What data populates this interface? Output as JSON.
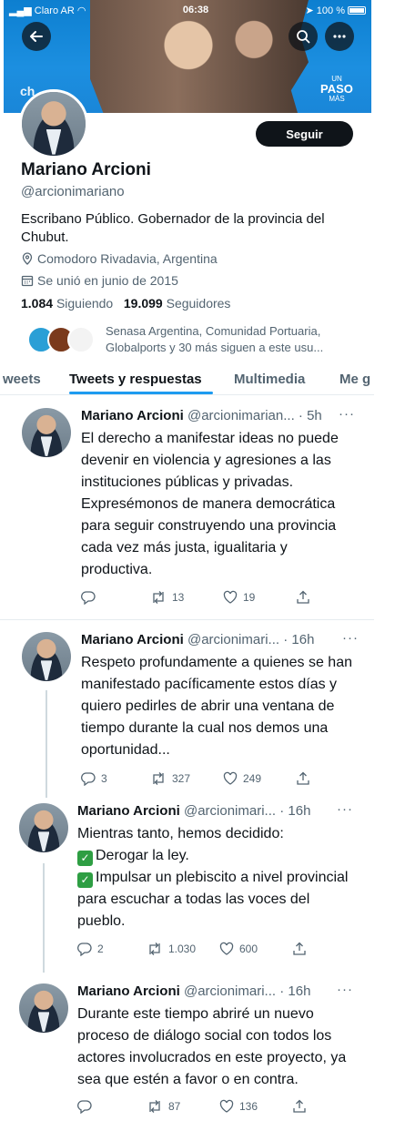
{
  "status_bar": {
    "carrier": "Claro AR",
    "time": "06:38",
    "battery": "100 %"
  },
  "banner": {
    "mark": "ch",
    "slogan_top": "UN",
    "slogan_big": "PASO",
    "slogan_bottom": "MÁS"
  },
  "header": {
    "back_icon": "arrow-left-icon",
    "search_icon": "search-icon",
    "more_icon": "more-icon"
  },
  "profile": {
    "follow_label": "Seguir",
    "name": "Mariano Arcioni",
    "handle": "@arcionimariano",
    "bio": "Escribano Público. Gobernador de la provincia del Chubut.",
    "location": "Comodoro Rivadavia, Argentina",
    "joined": "Se unió en junio de 2015",
    "following_count": "1.084",
    "following_label": "Siguiendo",
    "followers_count": "19.099",
    "followers_label": "Seguidores",
    "known_followers": "Senasa Argentina, Comunidad Portuaria, Globalports y 30 más siguen a este usu..."
  },
  "tabs": [
    "weets",
    "Tweets y respuestas",
    "Multimedia",
    "Me g"
  ],
  "tweets": [
    {
      "name": "Mariano Arcioni",
      "handle": "@arcionimarian...",
      "time": "· 5h",
      "text": "El derecho a manifestar ideas no puede devenir en violencia y agresiones a las instituciones públicas y privadas. Expresémonos de manera democrática para seguir construyendo una provincia cada vez más justa, igualitaria y productiva.",
      "replies": "",
      "retweets": "13",
      "likes": "19"
    },
    {
      "name": "Mariano Arcioni",
      "handle": "@arcionimari...",
      "time": "· 16h",
      "text": "Respeto profundamente a quienes se han manifestado pacíficamente estos días y quiero pedirles de abrir una ventana de tiempo durante la cual nos demos una oportunidad...",
      "replies": "3",
      "retweets": "327",
      "likes": "249"
    },
    {
      "name": "Mariano Arcioni",
      "handle": "@arcionimari...",
      "time": "· 16h",
      "line1": "Mientras tanto, hemos decidido:",
      "line2": "Derogar la ley.",
      "line3": "Impulsar un plebiscito a nivel provincial para escuchar a todas las voces del pueblo.",
      "replies": "2",
      "retweets": "1.030",
      "likes": "600"
    },
    {
      "name": "Mariano Arcioni",
      "handle": "@arcionimari...",
      "time": "· 16h",
      "text": "Durante este tiempo abriré un nuevo proceso de diálogo social con todos los actores involucrados en este proyecto, ya sea que estén a favor o en contra.",
      "replies": "",
      "retweets": "87",
      "likes": "136"
    }
  ],
  "colors": {
    "accent": "#1d9bf0",
    "text": "#0f1419",
    "secondary": "#536471",
    "check": "#2e9e43"
  }
}
